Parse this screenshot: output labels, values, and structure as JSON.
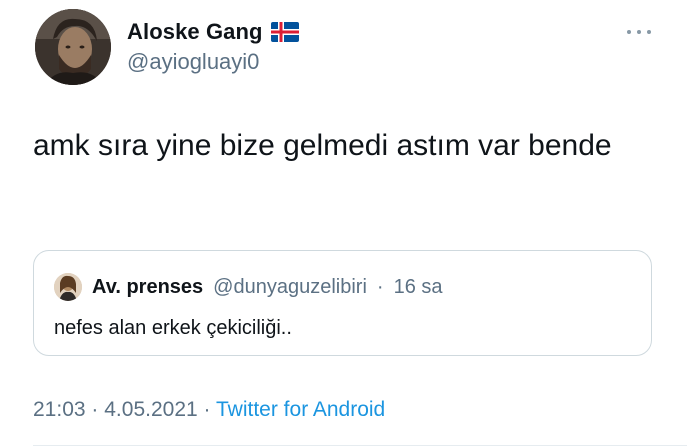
{
  "author": {
    "display_name": "Aloske Gang",
    "handle": "@ayiogluayi0",
    "flag": "iceland-flag"
  },
  "tweet": {
    "text": "amk sıra yine bize gelmedi astım var bende"
  },
  "quoted_tweet": {
    "display_name": "Av. prenses",
    "handle": "@dunyaguzelibiri",
    "separator": "·",
    "time": "16 sa",
    "text": "nefes alan erkek çekiciliği.."
  },
  "meta": {
    "time": "21:03",
    "separator1": "·",
    "date": "4.05.2021",
    "separator2": "·",
    "source": "Twitter for Android"
  },
  "colors": {
    "text": "#0f1419",
    "secondary": "#5b7083",
    "link": "#1b95e0",
    "border": "#cfd9de"
  },
  "icons": [
    "more-icon",
    "iceland-flag-icon",
    "avatar",
    "quoted-avatar"
  ]
}
